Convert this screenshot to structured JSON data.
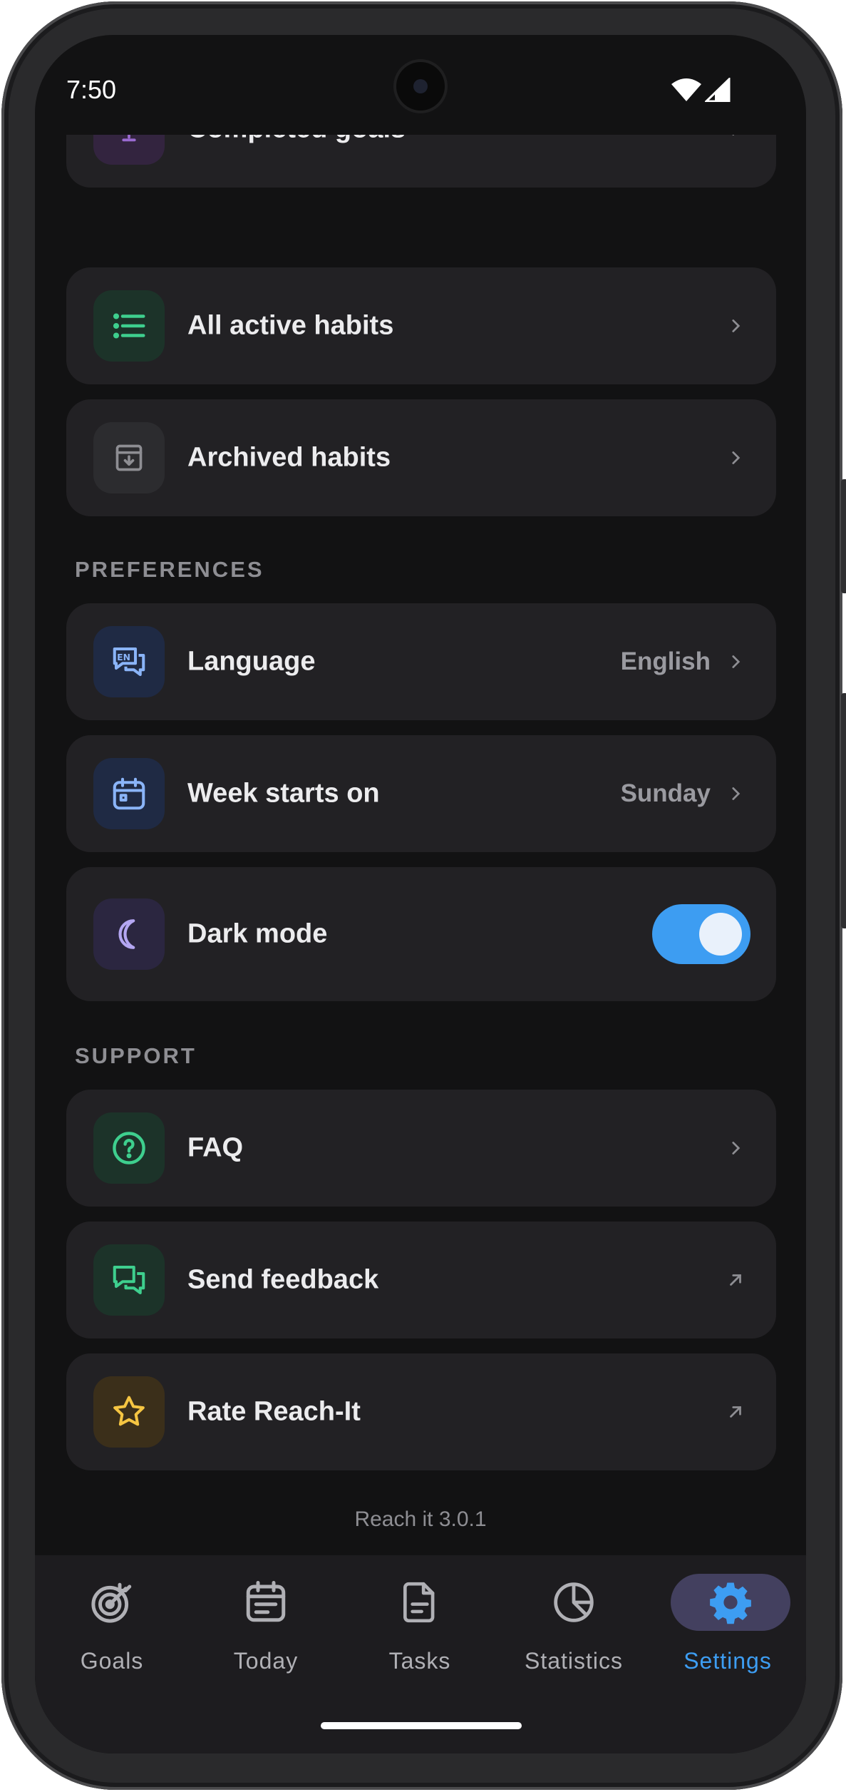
{
  "status_bar": {
    "time": "7:50"
  },
  "lists": {
    "completed_goals": "Completed goals",
    "all_active_habits": "All active habits",
    "archived_habits": "Archived habits"
  },
  "preferences": {
    "title": "PREFERENCES",
    "language": {
      "label": "Language",
      "value": "English"
    },
    "week_start": {
      "label": "Week starts on",
      "value": "Sunday"
    },
    "dark_mode": {
      "label": "Dark mode",
      "enabled": true
    }
  },
  "support": {
    "title": "SUPPORT",
    "faq": "FAQ",
    "feedback": "Send feedback",
    "rate": "Rate Reach-It"
  },
  "version": "Reach it 3.0.1",
  "nav": {
    "goals": "Goals",
    "today": "Today",
    "tasks": "Tasks",
    "statistics": "Statistics",
    "settings": "Settings",
    "active": "settings"
  },
  "colors": {
    "accent": "#3d9df2",
    "background": "#121213",
    "card": "#222124",
    "purple_icon": "#9a6ad0",
    "green_icon": "#3ecf8e",
    "blue_icon": "#8ab4f8",
    "lavender_icon": "#b4a6f2",
    "yellow_icon": "#f5c542"
  },
  "icons": {
    "completed_goals": "trophy-icon",
    "all_active_habits": "list-icon",
    "archived_habits": "archive-icon",
    "language": "translate-icon",
    "week_start": "calendar-icon",
    "dark_mode": "moon-icon",
    "faq": "help-circle-icon",
    "feedback": "chat-icon",
    "rate": "star-icon"
  }
}
